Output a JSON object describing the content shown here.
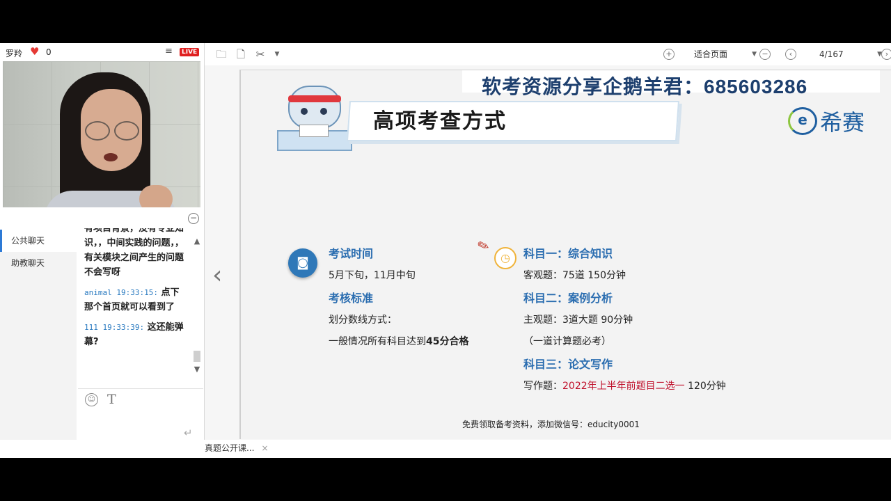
{
  "stream": {
    "user_name": "罗羚",
    "like_count": "0",
    "live_label": "LIVE"
  },
  "chat": {
    "tabs": [
      "公共聊天",
      "助教聊天"
    ],
    "messages": [
      {
        "meta": "",
        "text": "有项目背景，没有专业知识，，中间实践的问题，，有关模块之间产生的问题不会写呀"
      },
      {
        "meta": "animal 19:33:15:",
        "text": "点下那个首页就可以看到了"
      },
      {
        "meta": "111 19:33:39:",
        "text": "这还能弹幕?"
      }
    ]
  },
  "toolbar": {
    "fit_label": "适合页面",
    "page_indicator": "4/167"
  },
  "slide": {
    "banner_text": "软考资源分享企鹅羊君：",
    "banner_number": "685603286",
    "title": "高项考查方式",
    "logo_text": "希赛",
    "left_items": [
      {
        "heading": "考试时间",
        "text": "5月下旬，11月中旬"
      },
      {
        "heading": "考核标准",
        "text": "划分数线方式：",
        "text2_prefix": "一般情况所有科目达到",
        "text2_bold": "45分合格"
      }
    ],
    "subjects": [
      {
        "heading": "科目一：综合知识",
        "lines": [
          "客观题：75道  150分钟"
        ]
      },
      {
        "heading": "科目二：案例分析",
        "lines": [
          "主观题：3道大题  90分钟",
          "（一道计算题必考）"
        ]
      },
      {
        "heading": "科目三：论文写作",
        "line_prefix": "写作题：",
        "line_red": "2022年上半年前题目二选一",
        "line_suffix": "  120分钟"
      }
    ],
    "footer": "免费领取备考资料，添加微信号：educity0001"
  },
  "bottom": {
    "doc_tab": "真题公开课..."
  }
}
